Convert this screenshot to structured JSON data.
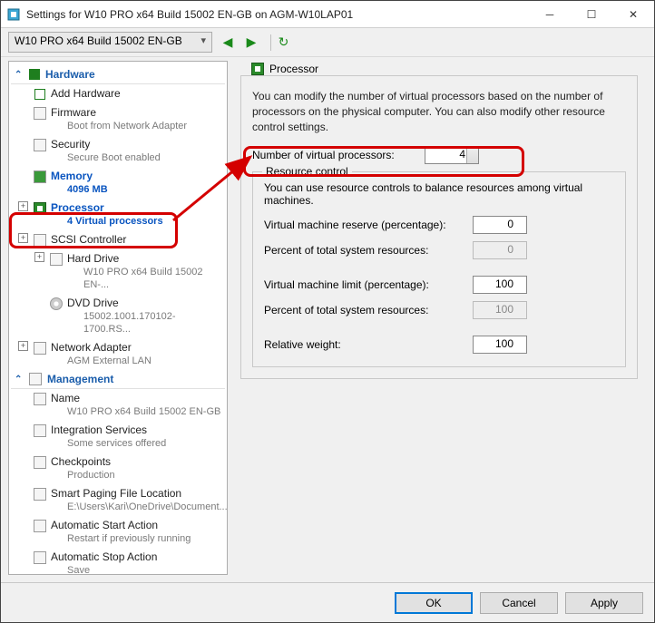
{
  "window": {
    "title": "Settings for W10 PRO x64 Build 15002 EN-GB on AGM-W10LAP01"
  },
  "toolbar": {
    "vm_name": "W10 PRO x64 Build 15002 EN-GB"
  },
  "sections": {
    "hardware": "Hardware",
    "management": "Management"
  },
  "tree": {
    "add_hardware": "Add Hardware",
    "firmware": "Firmware",
    "firmware_sub": "Boot from Network Adapter",
    "security": "Security",
    "security_sub": "Secure Boot enabled",
    "memory": "Memory",
    "memory_sub": "4096 MB",
    "processor": "Processor",
    "processor_sub": "4 Virtual processors",
    "scsi": "SCSI Controller",
    "hd": "Hard Drive",
    "hd_sub": "W10 PRO x64 Build 15002 EN-...",
    "dvd": "DVD Drive",
    "dvd_sub": "15002.1001.170102-1700.RS...",
    "net": "Network Adapter",
    "net_sub": "AGM External LAN",
    "name": "Name",
    "name_sub": "W10 PRO x64 Build 15002 EN-GB",
    "integ": "Integration Services",
    "integ_sub": "Some services offered",
    "chk": "Checkpoints",
    "chk_sub": "Production",
    "spf": "Smart Paging File Location",
    "spf_sub": "E:\\Users\\Kari\\OneDrive\\Document...",
    "asa": "Automatic Start Action",
    "asa_sub": "Restart if previously running",
    "astop": "Automatic Stop Action",
    "astop_sub": "Save"
  },
  "detail": {
    "title": "Processor",
    "description": "You can modify the number of virtual processors based on the number of processors on the physical computer. You can also modify other resource control settings.",
    "num_label": "Number of virtual processors:",
    "num_value": "4",
    "rc_legend": "Resource control",
    "rc_info": "You can use resource controls to balance resources among virtual machines.",
    "reserve_label": "Virtual machine reserve (percentage):",
    "reserve_value": "0",
    "pct_total_label": "Percent of total system resources:",
    "pct_total_value": "0",
    "limit_label": "Virtual machine limit (percentage):",
    "limit_value": "100",
    "pct_total2_value": "100",
    "weight_label": "Relative weight:",
    "weight_value": "100"
  },
  "footer": {
    "ok": "OK",
    "cancel": "Cancel",
    "apply": "Apply"
  }
}
